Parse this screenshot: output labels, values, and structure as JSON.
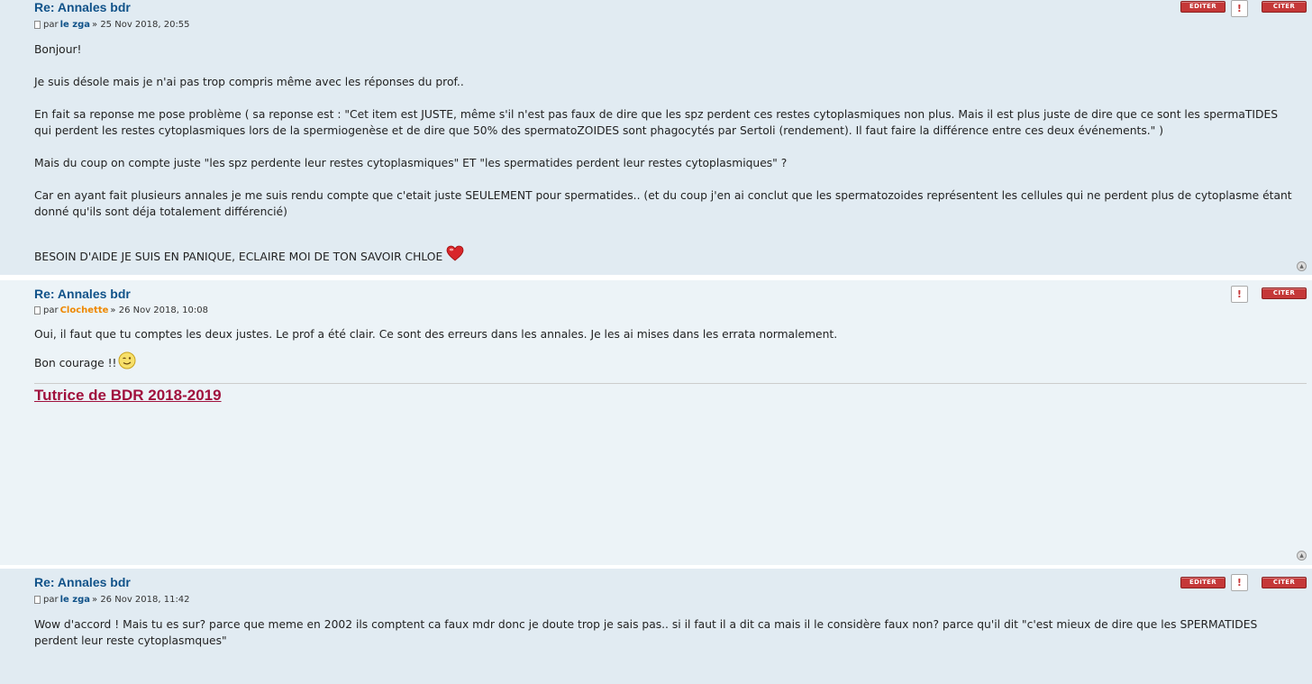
{
  "posts": [
    {
      "title": "Re: Annales bdr",
      "by_label": "par",
      "author": "le zga",
      "date": "» 25 Nov 2018, 20:55",
      "buttons": {
        "edit": "EDITER",
        "report": "!",
        "quote": "CITER"
      },
      "paragraphs": [
        "Bonjour!",
        "Je suis désole mais je n'ai pas trop compris même avec les réponses du prof..",
        "En fait sa reponse me pose problème ( sa reponse est : \"Cet item est JUSTE, même s'il n'est pas faux de dire que les spz perdent ces restes cytoplasmiques non plus. Mais il est plus juste de dire que ce sont les spermaTIDES qui perdent les restes cytoplasmiques lors de la spermiogenèse et de dire que 50% des spermatoZOIDES sont phagocytés par Sertoli (rendement). Il faut faire la différence entre ces deux événements.\" )",
        "Mais du coup on compte juste \"les spz perdente leur restes cytoplasmiques\" ET \"les spermatides perdent leur restes cytoplasmiques\" ?",
        "Car en ayant fait plusieurs annales je me suis rendu compte que c'etait juste SEULEMENT pour spermatides.. (et du coup j'en ai conclut que les spermatozoides représentent les cellules qui ne perdent plus de cytoplasme étant donné qu'ils sont déja totalement différencié)",
        "BESOIN D'AIDE JE SUIS EN PANIQUE, ECLAIRE MOI DE TON SAVOIR CHLOE"
      ]
    },
    {
      "title": "Re: Annales bdr",
      "by_label": "par",
      "author": "Clochette",
      "date": "» 26 Nov 2018, 10:08",
      "buttons": {
        "report": "!",
        "quote": "CITER"
      },
      "paragraphs": [
        "Oui, il faut que tu comptes les deux justes. Le prof a été clair. Ce sont des erreurs dans les annales. Je les ai mises dans les errata normalement.",
        "Bon courage !!"
      ],
      "signature": "Tutrice de BDR 2018-2019"
    },
    {
      "title": "Re: Annales bdr",
      "by_label": "par",
      "author": "le zga",
      "date": "» 26 Nov 2018, 11:42",
      "buttons": {
        "edit": "EDITER",
        "report": "!",
        "quote": "CITER"
      },
      "paragraphs": [
        "Wow d'accord ! Mais tu es sur? parce que meme en 2002 ils comptent ca faux mdr donc je doute trop je sais pas.. si il faut il a dit ca mais il le considère faux non? parce qu'il dit \"c'est mieux de dire que les SPERMATIDES perdent leur reste cytoplasmques\""
      ]
    }
  ],
  "colors": {
    "post_bg_1": "#e1ebf2",
    "post_bg_2": "#ecf3f7",
    "title": "#105289",
    "author_mod": "#ee8800",
    "button_red": "#c53838",
    "signature": "#a0103d"
  },
  "icons": {
    "post_icon": "post-icon",
    "heart": "heart-icon",
    "smiley": "wink-smiley-icon",
    "top": "back-to-top-icon"
  }
}
